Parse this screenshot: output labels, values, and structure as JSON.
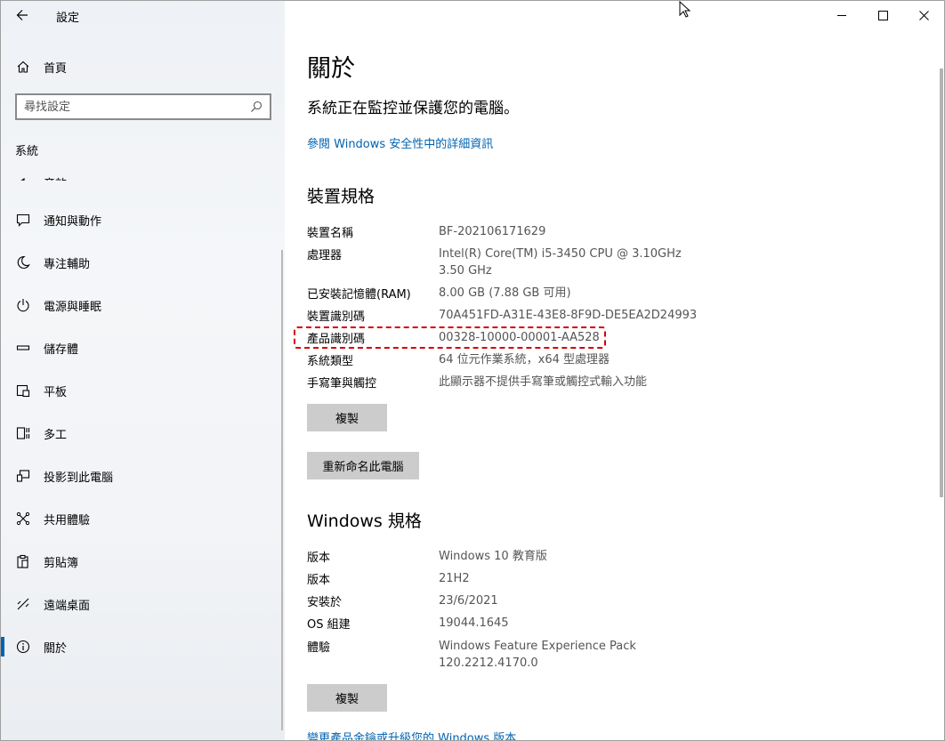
{
  "window": {
    "title": "設定",
    "caption_buttons": [
      "minimize",
      "maximize",
      "close"
    ]
  },
  "sidebar": {
    "home_label": "首頁",
    "search_placeholder": "尋找設定",
    "section_title": "系統",
    "partial_item_label": "音效",
    "items": [
      {
        "label": "通知與動作",
        "icon": "message-icon"
      },
      {
        "label": "專注輔助",
        "icon": "moon-icon"
      },
      {
        "label": "電源與睡眠",
        "icon": "power-icon"
      },
      {
        "label": "儲存體",
        "icon": "storage-icon"
      },
      {
        "label": "平板",
        "icon": "tablet-icon"
      },
      {
        "label": "多工",
        "icon": "multitask-icon"
      },
      {
        "label": "投影到此電腦",
        "icon": "project-icon"
      },
      {
        "label": "共用體驗",
        "icon": "share-icon"
      },
      {
        "label": "剪貼簿",
        "icon": "clipboard-icon"
      },
      {
        "label": "遠端桌面",
        "icon": "remote-icon"
      },
      {
        "label": "關於",
        "icon": "info-icon",
        "active": true
      }
    ]
  },
  "main": {
    "title": "關於",
    "protection_text": "系統正在監控並保護您的電腦。",
    "security_link": "參閱 Windows 安全性中的詳細資訊",
    "device_specs": {
      "heading": "裝置規格",
      "rows": [
        {
          "key": "裝置名稱",
          "value": "BF-202106171629"
        },
        {
          "key": "處理器",
          "value": "Intel(R) Core(TM) i5-3450 CPU @ 3.10GHz   3.50 GHz"
        },
        {
          "key": "已安裝記憶體(RAM)",
          "value": "8.00 GB (7.88 GB 可用)"
        },
        {
          "key": "裝置識別碼",
          "value": "70A451FD-A31E-43E8-8F9D-DE5EA2D24993"
        },
        {
          "key": "產品識別碼",
          "value": "00328-10000-00001-AA528"
        },
        {
          "key": "系統類型",
          "value": "64 位元作業系統，x64 型處理器"
        },
        {
          "key": "手寫筆與觸控",
          "value": "此顯示器不提供手寫筆或觸控式輸入功能"
        }
      ],
      "copy_button": "複製",
      "rename_button": "重新命名此電腦"
    },
    "windows_specs": {
      "heading": "Windows 規格",
      "rows": [
        {
          "key": "版本",
          "value": "Windows 10 教育版"
        },
        {
          "key": "版本",
          "value": "21H2"
        },
        {
          "key": "安裝於",
          "value": "23/6/2021"
        },
        {
          "key": "OS 組建",
          "value": "19044.1645"
        },
        {
          "key": "體驗",
          "value": "Windows Feature Experience Pack 120.2212.4170.0"
        }
      ],
      "copy_button": "複製",
      "change_key_link": "變更產品金鑰或升級您的 Windows 版本"
    }
  },
  "colors": {
    "accent": "#0063b1",
    "highlight": "#d40000",
    "button_bg": "#cccccc"
  }
}
